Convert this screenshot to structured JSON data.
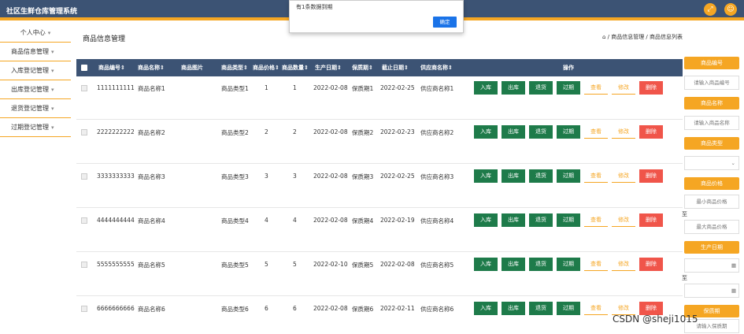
{
  "app": {
    "title": "社区生鲜仓库管理系统"
  },
  "topbar": {
    "icons": [
      "fullscreen-icon",
      "user-icon"
    ]
  },
  "dialog": {
    "message": "有1条数据到期",
    "ok_label": "确定"
  },
  "sidebar": {
    "items": [
      {
        "label": "个人中心",
        "caret": "▾"
      },
      {
        "label": "商品信息管理",
        "caret": "▾"
      },
      {
        "label": "入库登记管理",
        "caret": "▾"
      },
      {
        "label": "出库登记管理",
        "caret": "▾"
      },
      {
        "label": "退货登记管理",
        "caret": "▾"
      },
      {
        "label": "过期登记管理",
        "caret": "▾"
      }
    ]
  },
  "page": {
    "title": "商品信息管理",
    "breadcrumb": "⌂ / 商品信息管理 / 商品信息列表"
  },
  "table": {
    "headers": [
      "商品编号",
      "商品名称",
      "商品图片",
      "商品类型",
      "商品价格",
      "商品数量",
      "生产日期",
      "保质期",
      "截止日期",
      "供应商名称",
      "操作"
    ],
    "sort_mark": "⇕",
    "rows": [
      {
        "id": "1111111111",
        "name": "商品名称1",
        "type": "商品类型1",
        "price": "1",
        "qty": "1",
        "pdate": "2022-02-08",
        "shelf": "保质期1",
        "edate": "2022-02-25",
        "supplier": "供应商名称1"
      },
      {
        "id": "2222222222",
        "name": "商品名称2",
        "type": "商品类型2",
        "price": "2",
        "qty": "2",
        "pdate": "2022-02-08",
        "shelf": "保质期2",
        "edate": "2022-02-23",
        "supplier": "供应商名称2"
      },
      {
        "id": "3333333333",
        "name": "商品名称3",
        "type": "商品类型3",
        "price": "3",
        "qty": "3",
        "pdate": "2022-02-08",
        "shelf": "保质期3",
        "edate": "2022-02-25",
        "supplier": "供应商名称3"
      },
      {
        "id": "4444444444",
        "name": "商品名称4",
        "type": "商品类型4",
        "price": "4",
        "qty": "4",
        "pdate": "2022-02-08",
        "shelf": "保质期4",
        "edate": "2022-02-19",
        "supplier": "供应商名称4"
      },
      {
        "id": "5555555555",
        "name": "商品名称5",
        "type": "商品类型5",
        "price": "5",
        "qty": "5",
        "pdate": "2022-02-10",
        "shelf": "保质期5",
        "edate": "2022-02-08",
        "supplier": "供应商名称5"
      },
      {
        "id": "6666666666",
        "name": "商品名称6",
        "type": "商品类型6",
        "price": "6",
        "qty": "6",
        "pdate": "2022-02-08",
        "shelf": "保质期6",
        "edate": "2022-02-11",
        "supplier": "供应商名称6"
      }
    ],
    "actions": {
      "in": "入库",
      "out": "出库",
      "return": "退货",
      "expire": "过期",
      "view": "查看",
      "edit": "修改",
      "delete": "删除"
    }
  },
  "filter": {
    "code_label": "商品编号",
    "code_placeholder": "请输入商品编号",
    "name_label": "商品名称",
    "name_placeholder": "请输入商品名称",
    "type_label": "商品类型",
    "price_label": "商品价格",
    "price_min": "最小商品价格",
    "to": "至",
    "price_max": "最大商品价格",
    "pdate_label": "生产日期",
    "shelf_label": "保质期",
    "shelf_placeholder": "请输入保质期"
  },
  "watermark": "CSDN @sheji1015",
  "colors": {
    "header": "#3c5374",
    "accent": "#f5a623",
    "green": "#1e7b4a",
    "red": "#f0554a",
    "blue": "#1a73e8"
  }
}
